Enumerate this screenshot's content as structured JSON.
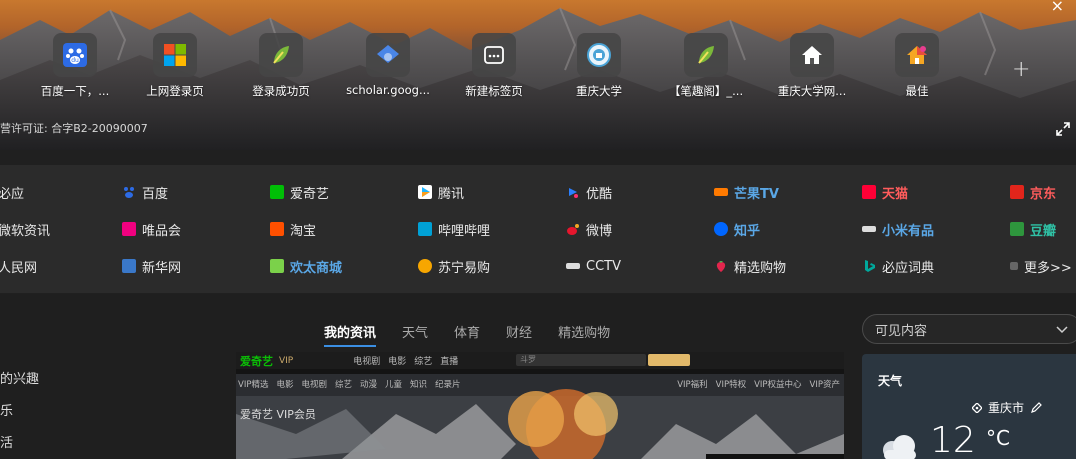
{
  "hero": {
    "license_text": "营许可证: 合字B2-20090007",
    "shortcuts": [
      {
        "label": "百度一下，...",
        "icon": "baidu-paw-icon",
        "color": "#2d6be5"
      },
      {
        "label": "上网登录页",
        "icon": "windows-logo-icon",
        "color": "#f25022"
      },
      {
        "label": "登录成功页",
        "icon": "leaf-logo-icon",
        "color": "#7bb83a"
      },
      {
        "label": "scholar.goog...",
        "icon": "scholar-cap-icon",
        "color": "#4a86e8"
      },
      {
        "label": "新建标签页",
        "icon": "new-tab-icon",
        "color": "#ffffff"
      },
      {
        "label": "重庆大学",
        "icon": "university-seal-icon",
        "color": "#4aa3d6"
      },
      {
        "label": "【笔趣阁】_...",
        "icon": "leaf-logo-icon",
        "color": "#7bb83a"
      },
      {
        "label": "重庆大学网...",
        "icon": "house-icon",
        "color": "#ffffff"
      },
      {
        "label": "最佳",
        "icon": "colorful-house-icon",
        "color": "#e84d3d"
      }
    ],
    "add_symbol": "+",
    "close_symbol": "×"
  },
  "links": [
    [
      {
        "label": "必应",
        "icon": "",
        "style": ""
      },
      {
        "label": "百度",
        "icon": "baidu-paw-icon",
        "style": ""
      },
      {
        "label": "爱奇艺",
        "icon": "iqiyi-icon",
        "style": ""
      },
      {
        "label": "腾讯",
        "icon": "tencent-play-icon",
        "style": ""
      },
      {
        "label": "优酷",
        "icon": "youku-icon",
        "style": ""
      },
      {
        "label": "芒果TV",
        "icon": "mango-tv-icon",
        "style": "blue"
      },
      {
        "label": "天猫",
        "icon": "tmall-icon",
        "style": "red"
      },
      {
        "label": "京东",
        "icon": "jd-icon",
        "style": "red"
      }
    ],
    [
      {
        "label": "微软资讯",
        "icon": "",
        "style": ""
      },
      {
        "label": "唯品会",
        "icon": "vip-shop-icon",
        "style": ""
      },
      {
        "label": "淘宝",
        "icon": "taobao-icon",
        "style": ""
      },
      {
        "label": "哔哩哔哩",
        "icon": "bilibili-icon",
        "style": ""
      },
      {
        "label": "微博",
        "icon": "weibo-icon",
        "style": ""
      },
      {
        "label": "知乎",
        "icon": "zhihu-icon",
        "style": "blue"
      },
      {
        "label": "小米有品",
        "icon": "xiaomi-youpin-icon",
        "style": "blue"
      },
      {
        "label": "豆瓣",
        "icon": "douban-icon",
        "style": "green"
      }
    ],
    [
      {
        "label": "人民网",
        "icon": "",
        "style": ""
      },
      {
        "label": "新华网",
        "icon": "xinhua-icon",
        "style": ""
      },
      {
        "label": "欢太商城",
        "icon": "heytap-icon",
        "style": "blue"
      },
      {
        "label": "苏宁易购",
        "icon": "suning-icon",
        "style": ""
      },
      {
        "label": "CCTV",
        "icon": "cctv-icon",
        "style": ""
      },
      {
        "label": "精选购物",
        "icon": "strawberry-icon",
        "style": ""
      },
      {
        "label": "必应词典",
        "icon": "bing-icon",
        "style": ""
      },
      {
        "label": "更多>>",
        "icon": "more-icon",
        "style": ""
      }
    ]
  ],
  "news": {
    "tabs": [
      "我的资讯",
      "天气",
      "体育",
      "财经",
      "精选购物"
    ],
    "active_tab": "我的资讯",
    "sidebar": [
      "的兴趣",
      "乐",
      "活"
    ]
  },
  "visible_content": {
    "label": "可见内容"
  },
  "weather": {
    "title": "天气",
    "city": "重庆市",
    "temp": "12",
    "unit": "°C"
  },
  "banner": {
    "brand": "爱奇艺",
    "brand_sub": "VIP会员",
    "vip_tag": "VIP",
    "nav": [
      "电视剧",
      "电影",
      "综艺",
      "直播"
    ],
    "search_placeholder": "斗罗",
    "menu": [
      "VIP精选",
      "电影",
      "电视剧",
      "综艺",
      "动漫",
      "儿童",
      "知识",
      "纪录片"
    ],
    "vip_menu": [
      "VIP福利",
      "VIP特权",
      "VIP权益中心",
      "VIP资产"
    ]
  },
  "colors": {
    "accent": "#3b8fe3",
    "link_blue": "#5aa7e6",
    "link_red": "#ff5c5c",
    "link_green": "#2fc1a5"
  }
}
